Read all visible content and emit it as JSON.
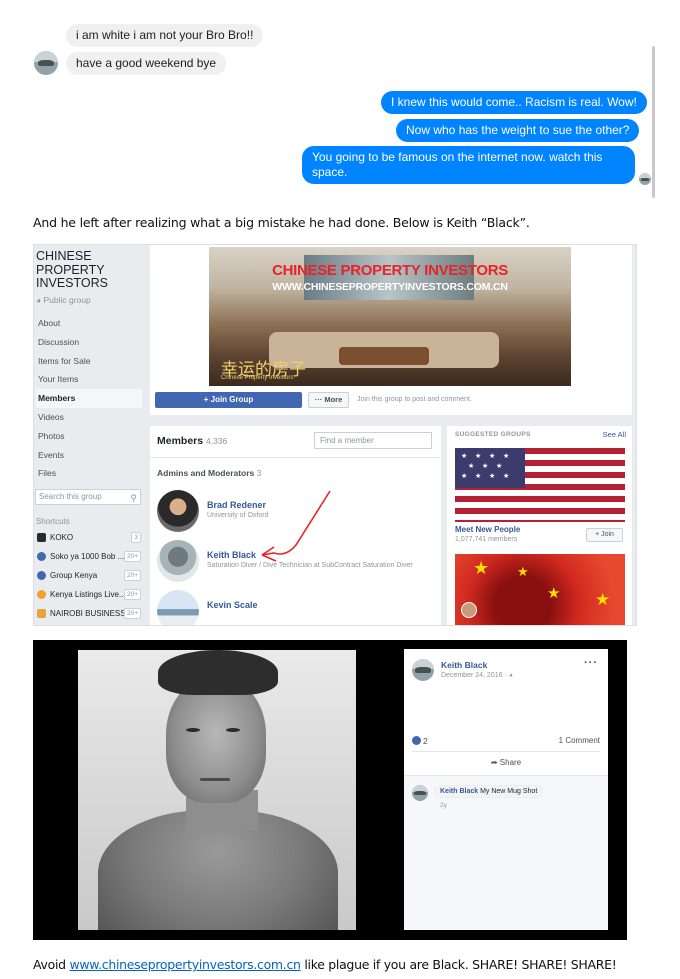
{
  "chat": {
    "received": [
      "i am white i am not your Bro Bro!!",
      "have a good weekend bye"
    ],
    "sent": [
      "I knew this would come.. Racism is real. Wow!",
      "Now who has the weight to sue the other?",
      "You going to be famous on the internet now. watch this space."
    ]
  },
  "caption": "And he left after realizing what a big mistake he had done. Below is Keith “Black”.",
  "fb_group": {
    "name": "CHINESE PROPERTY INVESTORS",
    "privacy": "Public group",
    "nav": [
      "About",
      "Discussion",
      "Items for Sale",
      "Your Items",
      "Members",
      "Videos",
      "Photos",
      "Events",
      "Files"
    ],
    "active_nav": "Members",
    "search_placeholder": "Search this group",
    "shortcuts_heading": "Shortcuts",
    "shortcuts": [
      {
        "label": "KOKO",
        "badge": "3"
      },
      {
        "label": "Soko ya 1000 Bob ...",
        "badge": "20+"
      },
      {
        "label": "Group Kenya",
        "badge": "20+"
      },
      {
        "label": "Kenya Listings Live...",
        "badge": "20+"
      },
      {
        "label": "NAIROBI BUSINESS",
        "badge": "20+"
      }
    ],
    "cover": {
      "title": "CHINESE PROPERTY INVESTORS",
      "url": "WWW.CHINESEPROPERTYINVESTORS.COM.CN",
      "chinese": "幸运的房子",
      "chinese_sub": "Chinese Property Investors"
    },
    "join_button": "+ Join Group",
    "more_button": "··· More",
    "join_hint": "Join this group to post and comment.",
    "members_title": "Members",
    "members_count": "4,336",
    "find_placeholder": "Find a member",
    "admins_title": "Admins and Moderators",
    "admins_count": "3",
    "admins": [
      {
        "name": "Brad Redener",
        "subtitle": "University of Oxford"
      },
      {
        "name": "Keith Black",
        "subtitle": "Saturation Diver / Dive Technician at SubContract Saturation Diver"
      },
      {
        "name": "Kevin Scale",
        "subtitle": ""
      }
    ],
    "suggested_title": "SUGGESTED GROUPS",
    "see_all": "See All",
    "suggested": [
      {
        "name": "Meet New People",
        "members": "1,077,741 members",
        "join": "+ Join"
      }
    ]
  },
  "photo_post": {
    "author": "Keith Black",
    "date": "December 24, 2016 ·",
    "more": "···",
    "likes": "2",
    "comments": "1 Comment",
    "share": "Share",
    "comment": {
      "author": "Keith Black",
      "text": "My New Mug Shot",
      "time": "2y"
    }
  },
  "footer": {
    "prefix": "Avoid ",
    "link": "www.chinesepropertyinvestors.com.cn",
    "suffix": " like plague if you are Black. SHARE! SHARE! SHARE!"
  },
  "colors": {
    "messenger_blue": "#0084ff",
    "incoming_bubble": "#f1f0f0",
    "facebook_blue": "#4267b2",
    "link_blue": "#365899",
    "annotation_red": "#e8232a"
  }
}
